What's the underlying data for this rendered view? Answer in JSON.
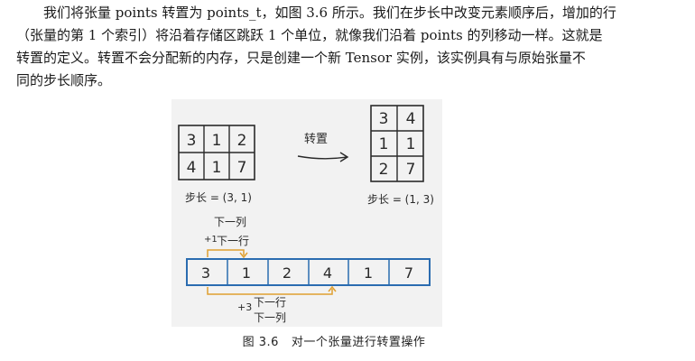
{
  "paragraph": {
    "line1": "我们将张量 points 转置为 points_t，如图 3.6 所示。我们在步长中改变元素顺序后，增加的行",
    "line2": "（张量的第 1 个索引）将沿着存储区跳跃 1 个单位，就像我们沿着 points 的列移动一样。这就是",
    "line3": "转置的定义。转置不会分配新的内存，只是创建一个新 Tensor 实例，该实例具有与原始张量不",
    "line4": "同的步长顺序。"
  },
  "figure": {
    "original_matrix": [
      [
        "3",
        "1",
        "2"
      ],
      [
        "4",
        "1",
        "7"
      ]
    ],
    "original_stride_label": "步长 = (3, 1)",
    "arrow_label": "转置",
    "transposed_matrix": [
      [
        "3",
        "4"
      ],
      [
        "1",
        "1"
      ],
      [
        "2",
        "7"
      ]
    ],
    "transposed_stride_label": "步长 = (1, 3)",
    "storage_values": [
      "3",
      "1",
      "2",
      "4",
      "1",
      "7"
    ],
    "top_jump_step": "+1",
    "top_jump_line1": "下一列",
    "top_jump_line2": "下一行",
    "bottom_jump_step": "+3",
    "bottom_jump_line1": "下一行",
    "bottom_jump_line2": "下一列",
    "caption_number": "图 3.6",
    "caption_text": "对一个张量进行转置操作",
    "accent_color": "#e0a030"
  }
}
